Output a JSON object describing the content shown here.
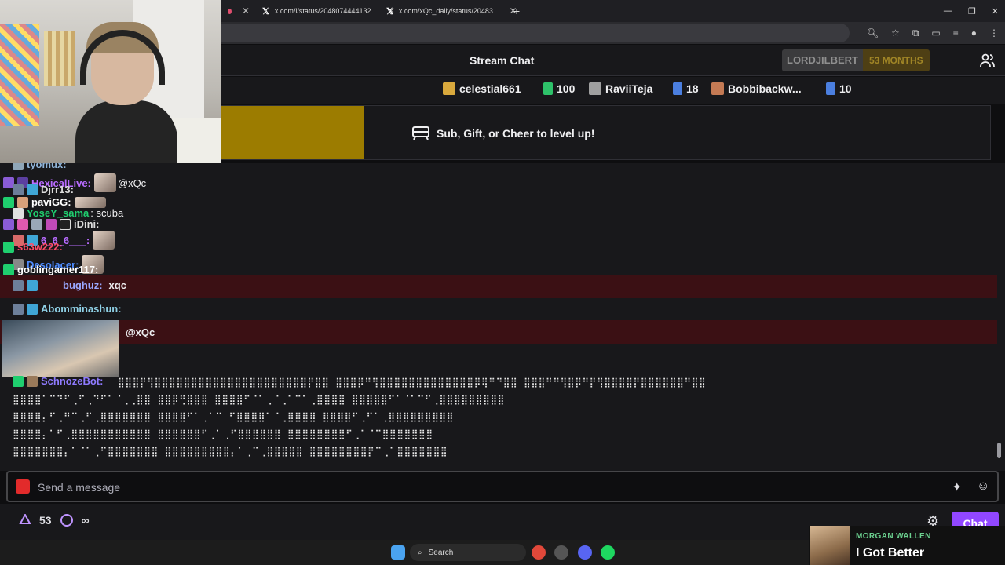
{
  "browser": {
    "tabs": [
      {
        "title": "x.com/i/status/2048074444132..."
      },
      {
        "title": "x.com/xQc_daily/status/20483..."
      }
    ],
    "new_tab": "+",
    "window_controls": [
      "—",
      "❐",
      "✕"
    ]
  },
  "chat": {
    "title": "Stream Chat",
    "sub_badge": {
      "username": "LORDJILBERT",
      "months": "53 MONTHS"
    }
  },
  "gifters": [
    {
      "name": "celestial661",
      "icon": "gift-icon"
    },
    {
      "name": "100",
      "icon": "gift-small-icon"
    },
    {
      "name": "RaviiTeja",
      "icon": "gift-icon"
    },
    {
      "name": "18",
      "icon": "gift-small-icon"
    },
    {
      "name": "Bobbibackw...",
      "icon": "gift-icon"
    },
    {
      "name": "10",
      "icon": "gift-small-icon"
    }
  ],
  "banner": {
    "text": "Sub, Gift, or Cheer to level up!"
  },
  "messages": [
    {
      "user": "tyomux:",
      "color": "#8fb4d9",
      "text": ""
    },
    {
      "user": "HexicalLive:",
      "color": "#b86bff",
      "text": "@xQc"
    },
    {
      "user": "Djrr13:",
      "color": "#dcdcdc",
      "text": ""
    },
    {
      "user": "paviGG:",
      "color": "#ffffff",
      "text": ""
    },
    {
      "user": "YoseY_sama",
      "color": "#1fcf6f",
      "text": ": scuba"
    },
    {
      "user": "iDini:",
      "color": "#dcdcdc",
      "text": ""
    },
    {
      "user": "6_6_6___:",
      "color": "#b86bff",
      "text": ""
    },
    {
      "user": "s63w222:",
      "color": "#ff4d6a",
      "text": ""
    },
    {
      "user": "Desolacer:",
      "color": "#4d8bff",
      "text": ""
    },
    {
      "user": "goblingamer117:",
      "color": "#ffffff",
      "text": ""
    },
    {
      "user": "bughuz:",
      "color": "#9aa8ff",
      "text": "xqc"
    },
    {
      "user": "Abomminashun:",
      "color": "#8fd1e6",
      "text": ""
    },
    {
      "user": "",
      "color": "#efeff1",
      "text": "@xQc"
    },
    {
      "user": "SchnozeBot:",
      "color": "#8f7bff",
      "text": ""
    }
  ],
  "input": {
    "placeholder": "Send a message"
  },
  "bottom": {
    "points": "53",
    "infinity": "∞",
    "chat_button": "Chat"
  },
  "taskbar": {
    "search": "Search"
  },
  "now_playing": {
    "artist": "MORGAN WALLEN",
    "song": "I Got Better"
  }
}
